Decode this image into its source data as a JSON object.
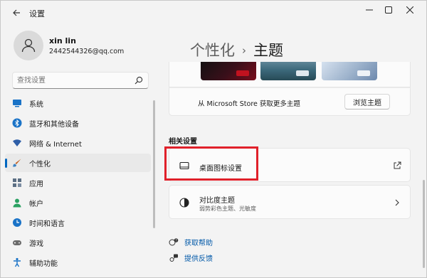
{
  "window": {
    "title": "设置",
    "back_icon": "back-arrow-icon",
    "controls": [
      "minimize-icon",
      "maximize-icon",
      "close-icon"
    ]
  },
  "profile": {
    "name": "xin lin",
    "email": "2442544326@qq.com",
    "avatar_icon": "person-icon"
  },
  "search": {
    "placeholder": "查找设置",
    "value": "",
    "icon": "search-icon"
  },
  "sidebar": {
    "items": [
      {
        "label": "系统",
        "icon": "monitor-icon",
        "color": "#1a73c7"
      },
      {
        "label": "蓝牙和其他设备",
        "icon": "bluetooth-icon",
        "color": "#1a73c7"
      },
      {
        "label": "网络 & Internet",
        "icon": "network-icon",
        "color": "#2f5fa8"
      },
      {
        "label": "个性化",
        "icon": "brush-icon",
        "color": "#c25d1c",
        "active": true
      },
      {
        "label": "应用",
        "icon": "apps-icon",
        "color": "#5c6f84"
      },
      {
        "label": "帐户",
        "icon": "account-icon",
        "color": "#2aa162"
      },
      {
        "label": "时间和语言",
        "icon": "globe-clock-icon",
        "color": "#1a73c7"
      },
      {
        "label": "游戏",
        "icon": "gamepad-icon",
        "color": "#6b6b6b"
      },
      {
        "label": "辅助功能",
        "icon": "accessibility-icon",
        "color": "#1a73c7"
      }
    ],
    "accent": "#0067c0"
  },
  "main": {
    "breadcrumb": {
      "parent": "个性化",
      "separator": "›",
      "current": "主题"
    },
    "store_row": {
      "text": "从 Microsoft Store 获取更多主题",
      "button": "浏览主题"
    },
    "related_title": "相关设置",
    "cards": [
      {
        "title": "桌面图标设置",
        "icon": "desktop-icon",
        "action_icon": "external-link-icon"
      },
      {
        "title": "对比度主题",
        "subtitle": "弱势彩色主题、光敏度",
        "icon": "contrast-icon",
        "action_icon": "chevron-right-icon"
      }
    ],
    "help_links": [
      {
        "label": "获取帮助",
        "icon": "help-icon"
      },
      {
        "label": "提供反馈",
        "icon": "feedback-icon"
      }
    ],
    "highlight_color": "#e0202a"
  }
}
